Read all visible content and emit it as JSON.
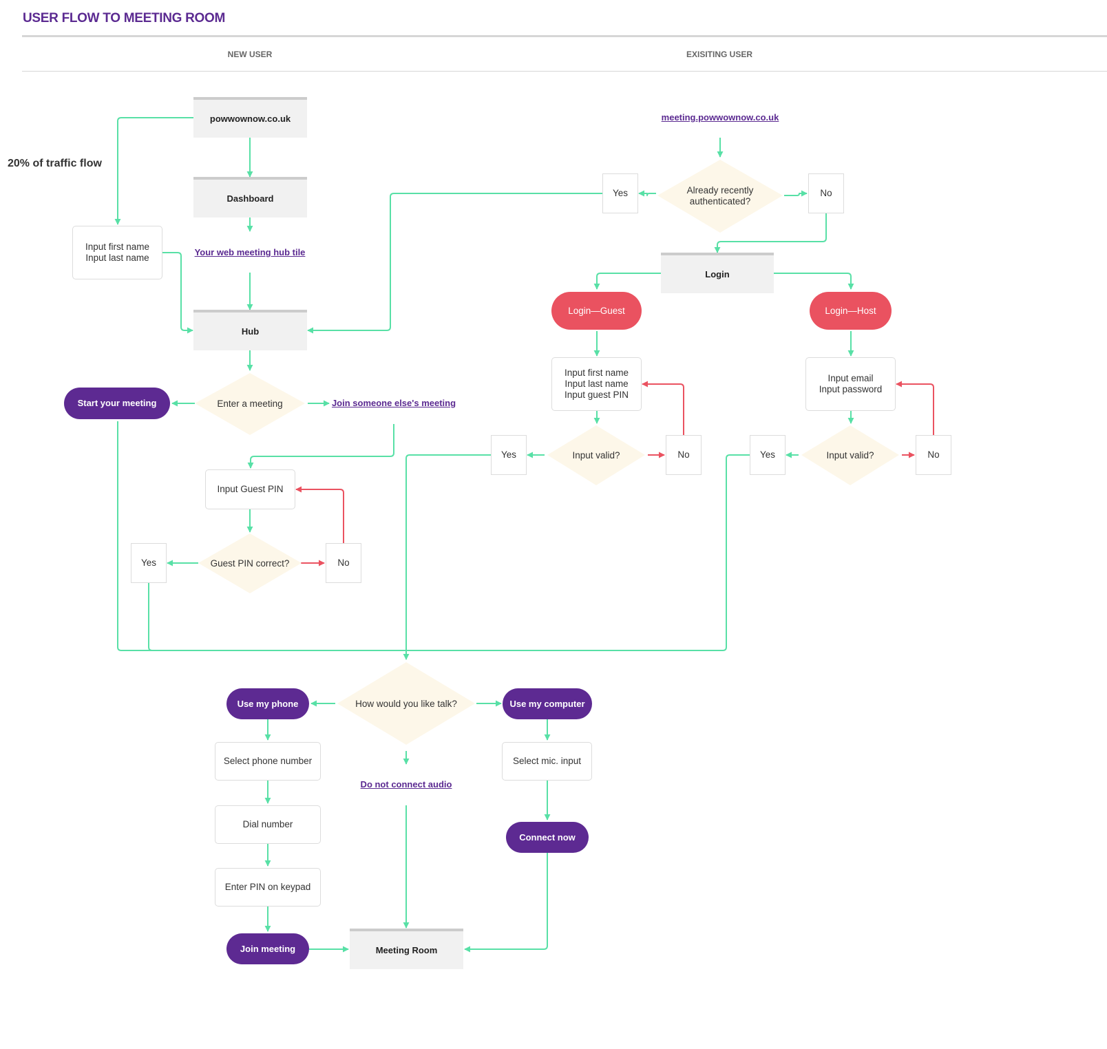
{
  "title": "USER FLOW TO MEETING ROOM",
  "columns": {
    "new_user": "NEW USER",
    "existing_user": "EXISITING USER"
  },
  "side_note": "20% of traffic flow",
  "colors": {
    "flow": "#58e0a6",
    "reject": "#ea5260",
    "brand_purple": "#5d2a92",
    "decision_fill": "#fdf7e9",
    "page_fill": "#f1f1f1"
  },
  "new_user": {
    "site": "powwownow.co.uk",
    "dashboard": "Dashboard",
    "hub_tile_link": "Your web meeting hub tile",
    "name_input": [
      "Input first name",
      "Input last name"
    ],
    "hub": "Hub",
    "enter_meeting": "Enter a meeting",
    "start_meeting": "Start your meeting",
    "join_other_link": "Join someone else's meeting",
    "guest_pin_input": "Input Guest PIN",
    "guest_pin_check": "Guest PIN correct?",
    "yes": "Yes",
    "no": "No"
  },
  "existing_user": {
    "site_link": "meeting.powwownow.co.uk",
    "auth_check": [
      "Already recently",
      "authenticated?"
    ],
    "yes": "Yes",
    "no": "No",
    "login": "Login",
    "login_guest": "Login—Guest",
    "login_host": "Login—Host",
    "guest_inputs": [
      "Input first name",
      "Input last name",
      "Input guest PIN"
    ],
    "host_inputs": [
      "Input email",
      "Input password"
    ],
    "valid_check": "Input valid?",
    "guest_yes": "Yes",
    "guest_no": "No",
    "host_yes": "Yes",
    "host_no": "No"
  },
  "audio": {
    "question": "How would you like talk?",
    "use_phone": "Use my phone",
    "use_computer": "Use my computer",
    "select_phone": "Select phone number",
    "dial": "Dial number",
    "enter_pin": "Enter PIN on keypad",
    "join_meeting": "Join meeting",
    "no_audio_link": "Do not connect audio",
    "select_mic": "Select mic. input",
    "connect_now": "Connect now",
    "meeting_room": "Meeting Room"
  }
}
